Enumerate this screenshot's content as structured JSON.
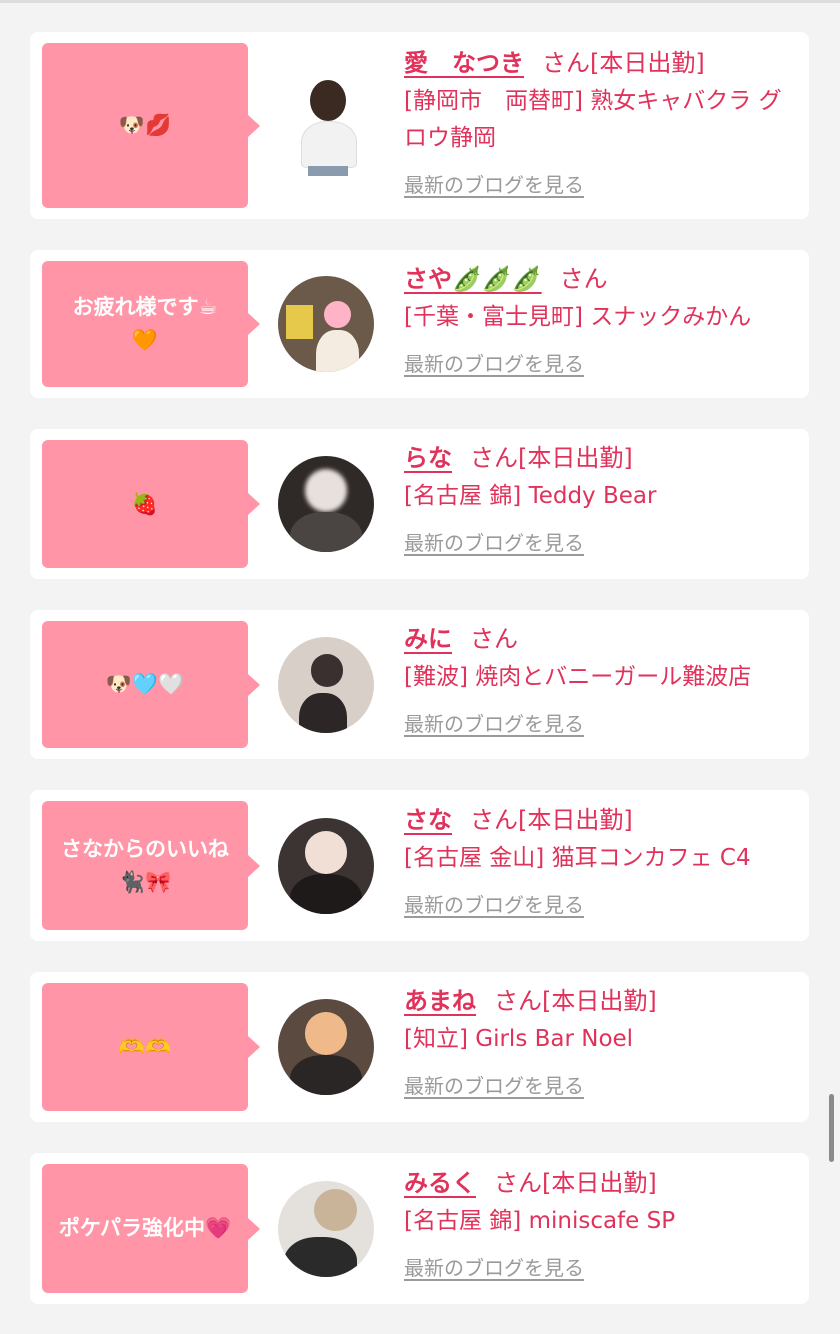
{
  "colors": {
    "accent": "#e0325a",
    "bubble": "#ff95a6",
    "link_gray": "#9a9a9a",
    "background": "#f3f3f3",
    "card": "#ffffff"
  },
  "cards": [
    {
      "bubble": "🐶💋",
      "name": "愛　なつき",
      "san": "さん",
      "status": "[本日出勤]",
      "shop": "[静岡市　両替町] 熟女キャバクラ グロウ静岡",
      "blog": "最新のブログを見る",
      "avatar_icon": "girl-photo-icon"
    },
    {
      "bubble": "お疲れ様です☕\n🧡",
      "name": "さや🫛🫛🫛",
      "san": "さん",
      "status": "",
      "shop": "[千葉・富士見町] スナックみかん",
      "blog": "最新のブログを見る",
      "avatar_icon": "girl-photo-icon"
    },
    {
      "bubble": "🍓",
      "name": "らな",
      "san": "さん",
      "status": "[本日出勤]",
      "shop": "[名古屋 錦] Teddy Bear",
      "blog": "最新のブログを見る",
      "avatar_icon": "girl-photo-icon"
    },
    {
      "bubble": "🐶🩵🤍",
      "name": "みに",
      "san": "さん",
      "status": "",
      "shop": "[難波] 焼肉とバニーガール難波店",
      "blog": "最新のブログを見る",
      "avatar_icon": "girl-photo-icon"
    },
    {
      "bubble": "さなからのいいね\n🐈‍⬛🎀",
      "name": "さな",
      "san": "さん",
      "status": "[本日出勤]",
      "shop": "[名古屋 金山] 猫耳コンカフェ C4",
      "blog": "最新のブログを見る",
      "avatar_icon": "girl-photo-icon"
    },
    {
      "bubble": "🫶🫶",
      "name": "あまね",
      "san": "さん",
      "status": "[本日出勤]",
      "shop": "[知立] Girls Bar Noel",
      "blog": "最新のブログを見る",
      "avatar_icon": "girl-photo-icon"
    },
    {
      "bubble": "ポケパラ強化中💗",
      "name": "みるく",
      "san": "さん",
      "status": "[本日出勤]",
      "shop": "[名古屋 錦] miniscafe SP",
      "blog": "最新のブログを見る",
      "avatar_icon": "girl-photo-icon"
    }
  ]
}
